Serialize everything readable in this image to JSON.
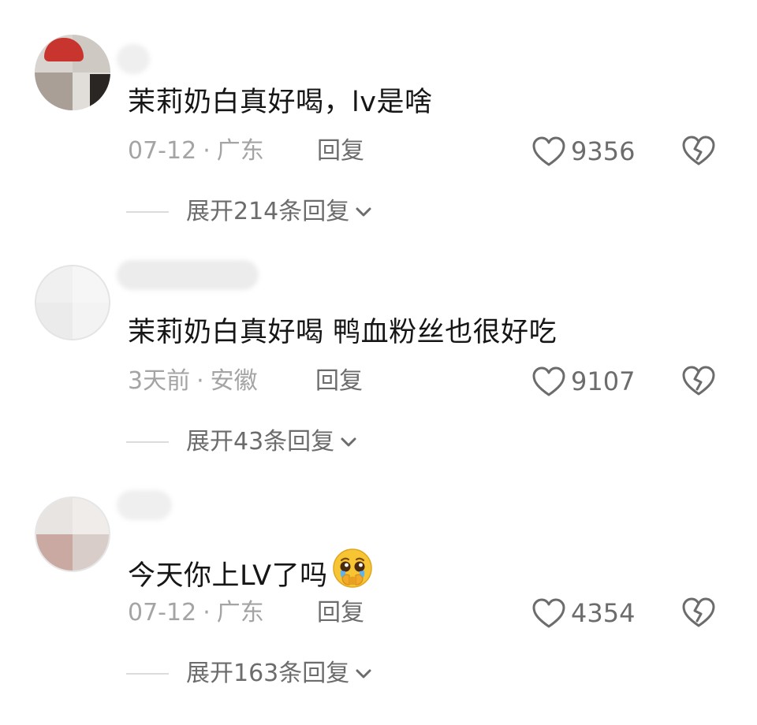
{
  "colors": {
    "text_primary": "#161616",
    "text_secondary": "#a4a4a4",
    "text_action": "#6c6c6c",
    "divider": "#dcdcdc"
  },
  "comments": [
    {
      "text": "茉莉奶白真好喝，lv是啥",
      "emoji": "",
      "date": "07-12",
      "separator": "·",
      "location": "广东",
      "reply_label": "回复",
      "like_icon": "heart-outline-icon",
      "likes": "9356",
      "dislike_icon": "broken-heart-icon",
      "expand_label": "展开214条回复",
      "expand_icon": "chevron-down-icon"
    },
    {
      "text": "茉莉奶白真好喝 鸭血粉丝也很好吃",
      "emoji": "",
      "date": "3天前",
      "separator": "·",
      "location": "安徽",
      "reply_label": "回复",
      "like_icon": "heart-outline-icon",
      "likes": "9107",
      "dislike_icon": "broken-heart-icon",
      "expand_label": "展开43条回复",
      "expand_icon": "chevron-down-icon"
    },
    {
      "text": "今天你上LV了吗",
      "emoji": "pleading-face-emoji",
      "date": "07-12",
      "separator": "·",
      "location": "广东",
      "reply_label": "回复",
      "like_icon": "heart-outline-icon",
      "likes": "4354",
      "dislike_icon": "broken-heart-icon",
      "expand_label": "展开163条回复",
      "expand_icon": "chevron-down-icon"
    }
  ]
}
